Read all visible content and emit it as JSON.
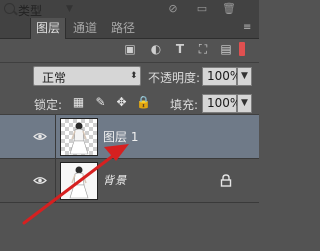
{
  "panel": {
    "tabs": [
      {
        "label": "图层",
        "active": true
      },
      {
        "label": "通道",
        "active": false
      },
      {
        "label": "路径",
        "active": false
      }
    ]
  },
  "filter": {
    "kind_label": "类型",
    "icons": [
      "pixel-filter-icon",
      "adjustment-filter-icon",
      "type-filter-icon",
      "shape-filter-icon",
      "smart-object-filter-icon"
    ]
  },
  "blend": {
    "mode": "正常",
    "opacity_label": "不透明度:",
    "opacity_value": "100%"
  },
  "lock": {
    "label": "锁定:",
    "fill_label": "填充:",
    "fill_value": "100%"
  },
  "layers": [
    {
      "name": "图层 1",
      "selected": true,
      "visible": true,
      "locked": false
    },
    {
      "name": "背景",
      "selected": false,
      "visible": true,
      "locked": true
    }
  ],
  "colors": {
    "panel_bg": "#535353",
    "selected_row": "#6f7a88",
    "annotation_arrow": "#d62020"
  }
}
